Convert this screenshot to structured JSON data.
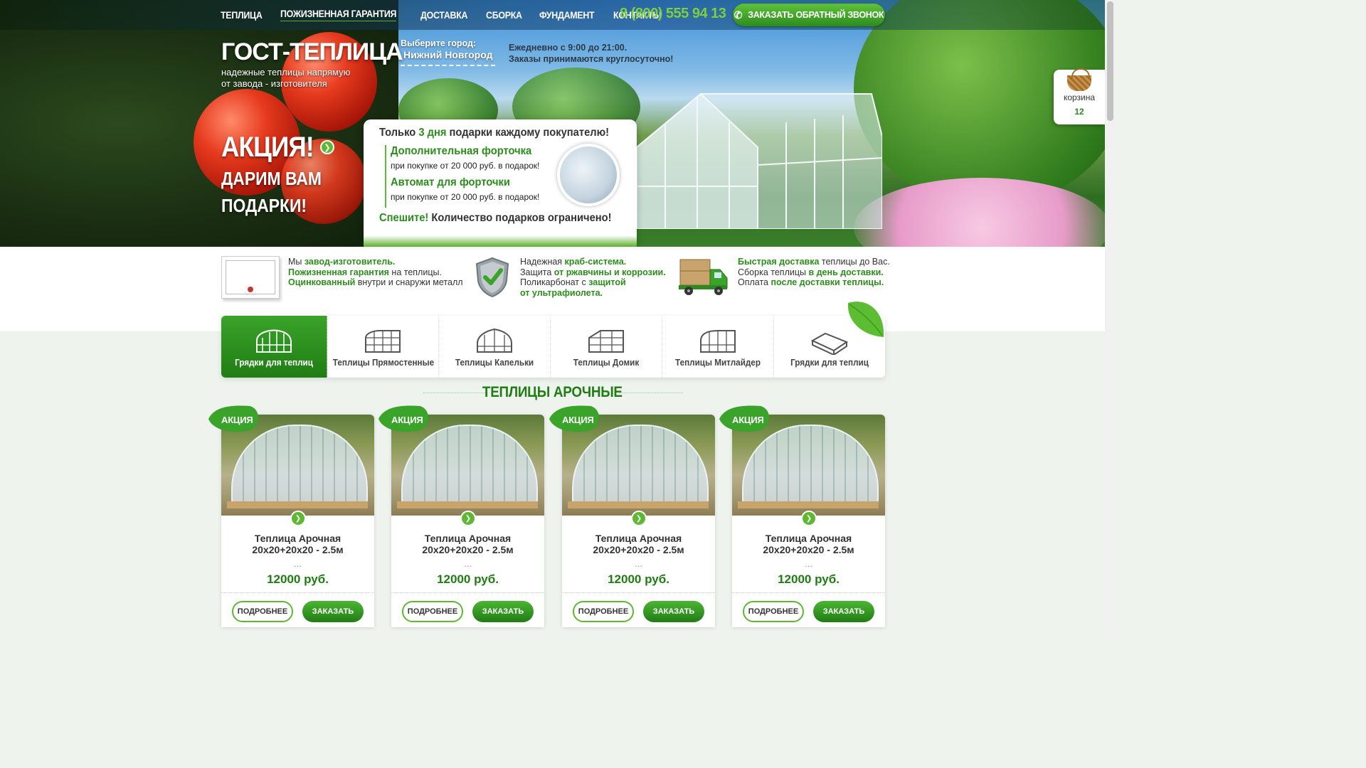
{
  "nav": {
    "items": [
      "ТЕПЛИЦА",
      "ПОЖИЗНЕННАЯ ГАРАНТИЯ",
      "ДОСТАВКА",
      "СБОРКА",
      "ФУНДАМЕНТ",
      "КОНТАКТЫ"
    ],
    "phone": "8 (800) 555 94 13",
    "callback_label": "ЗАКАЗАТЬ ОБРАТНЫЙ ЗВОНОК"
  },
  "header": {
    "logo": "ГОСТ-ТЕПЛИЦА",
    "tagline_1": "надежные теплицы напрямую",
    "tagline_2": "от завода - изготовителя",
    "city_label": "Выберите город:",
    "city_value": "Нижний Новгород",
    "hours_1": "Ежедневно с 9:00 до 21:00.",
    "hours_2": "Заказы принимаются круглосуточно!"
  },
  "promo": {
    "title": "АКЦИЯ!",
    "line_1": "ДАРИМ ВАМ",
    "line_2": "ПОДАРКИ!",
    "card_head_pre": "Только ",
    "card_head_accent": "3 дня",
    "card_head_post": " подарки каждому покупателю!",
    "gift_1_title": "Дополнительная форточка",
    "gift_1_sub": "при покупке от 20 000 руб. в подарок!",
    "gift_2_title": "Автомат для форточки",
    "gift_2_sub": "при покупке от 20 000 руб. в подарок!",
    "foot_accent": "Спешите!",
    "foot_rest": " Количество подарков ограничено!"
  },
  "cart": {
    "label": "корзина",
    "count": "12"
  },
  "features": [
    {
      "l1_pre": "Мы ",
      "l1_b": "завод-изготовитель.",
      "l2_b": "Пожизненная гарантия",
      "l2_post": " на теплицы.",
      "l3_b": "Оцинкованный",
      "l3_post": " внутри и снаружи металл"
    },
    {
      "l1_pre": "Надежная ",
      "l1_b": "краб-система.",
      "l2_pre": "Защита ",
      "l2_b": "от ржавчины и коррозии.",
      "l3_pre": "Поликарбонат с ",
      "l3_b": "защитой",
      "l4_b": "от ультрафиолета."
    },
    {
      "l1_b": "Быстрая доставка",
      "l1_post": " теплицы до Вас.",
      "l2_pre": "Сборка теплицы ",
      "l2_b": "в день доставки.",
      "l3_pre": "Оплата ",
      "l3_b": "после доставки теплицы."
    }
  ],
  "tabs": [
    "Грядки для теплиц",
    "Теплицы Прямостенные",
    "Теплицы Капельки",
    "Теплицы Домик",
    "Теплицы Митлайдер",
    "Грядки для теплиц"
  ],
  "section_title": "ТЕПЛИЦЫ АРОЧНЫЕ",
  "products": [
    {
      "badge": "АКЦИЯ",
      "name": "Теплица Арочная\n20x20+20x20 - 2.5м",
      "dots": "...",
      "price": "12000  руб.",
      "more": "ПОДРОБНЕЕ",
      "order": "ЗАКАЗАТЬ"
    },
    {
      "badge": "АКЦИЯ",
      "name": "Теплица Арочная\n20x20+20x20 - 2.5м",
      "dots": "...",
      "price": "12000  руб.",
      "more": "ПОДРОБНЕЕ",
      "order": "ЗАКАЗАТЬ"
    },
    {
      "badge": "АКЦИЯ",
      "name": "Теплица Арочная\n20x20+20x20 - 2.5м",
      "dots": "...",
      "price": "12000  руб.",
      "more": "ПОДРОБНЕЕ",
      "order": "ЗАКАЗАТЬ"
    },
    {
      "badge": "АКЦИЯ",
      "name": "Теплица Арочная\n20x20+20x20 - 2.5м",
      "dots": "...",
      "price": "12000  руб.",
      "more": "ПОДРОБНЕЕ",
      "order": "ЗАКАЗАТЬ"
    }
  ],
  "colors": {
    "brand_green": "#207d14",
    "accent_green": "#5fb833",
    "phone_green": "#7ccf3e"
  }
}
